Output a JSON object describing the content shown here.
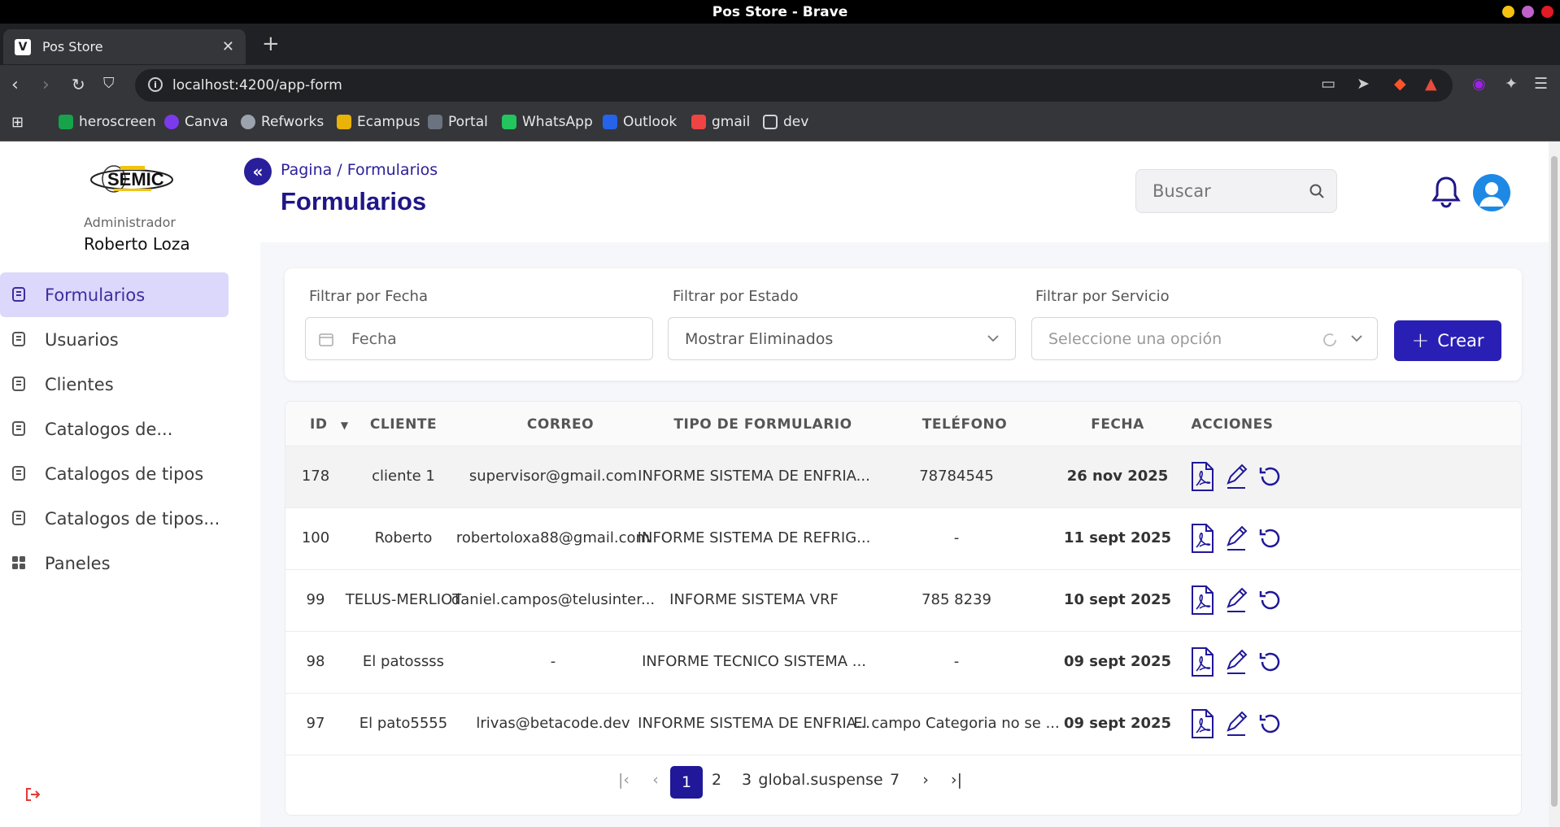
{
  "browser": {
    "window_title": "Pos Store - Brave",
    "tab_title": "Pos Store",
    "url": "localhost:4200/app-form",
    "bookmarks": [
      {
        "label": "heroscreen",
        "color": "#16a34a"
      },
      {
        "label": "Canva",
        "color": "#7c3aed"
      },
      {
        "label": "Refworks",
        "color": "#9ca3af"
      },
      {
        "label": "Ecampus",
        "color": "#eab308"
      },
      {
        "label": "Portal",
        "color": "#6b7280"
      },
      {
        "label": "WhatsApp",
        "color": "#22c55e"
      },
      {
        "label": "Outlook",
        "color": "#2563eb"
      },
      {
        "label": "gmail",
        "color": "#ef4444"
      },
      {
        "label": "dev",
        "color": "#d1d5db"
      }
    ]
  },
  "sidebar": {
    "role": "Administrador",
    "user_name": "Roberto Loza",
    "items": [
      {
        "label": "Formularios",
        "icon": "document-icon",
        "active": true
      },
      {
        "label": "Usuarios",
        "icon": "document-icon",
        "active": false
      },
      {
        "label": "Clientes",
        "icon": "document-icon",
        "active": false
      },
      {
        "label": "Catalogos de...",
        "icon": "document-icon",
        "active": false
      },
      {
        "label": "Catalogos de tipos",
        "icon": "document-icon",
        "active": false
      },
      {
        "label": "Catalogos de tipos...",
        "icon": "document-icon",
        "active": false
      },
      {
        "label": "Paneles",
        "icon": "grid-icon",
        "active": false
      }
    ]
  },
  "header": {
    "breadcrumb": "Pagina / Formularios",
    "title": "Formularios",
    "search_placeholder": "Buscar"
  },
  "filters": {
    "date_label": "Filtrar por Fecha",
    "date_placeholder": "Fecha",
    "status_label": "Filtrar por Estado",
    "status_value": "Mostrar Eliminados",
    "service_label": "Filtrar por Servicio",
    "service_placeholder": "Seleccione una opción",
    "create_label": "Crear"
  },
  "table": {
    "columns": [
      "ID",
      "CLIENTE",
      "CORREO",
      "TIPO DE FORMULARIO",
      "TELÉFONO",
      "FECHA",
      "ACCIONES"
    ],
    "rows": [
      {
        "id": "178",
        "cliente": "cliente 1",
        "correo": "supervisor@gmail.com",
        "tipo": "INFORME SISTEMA DE ENFRIA...",
        "telefono": "78784545",
        "fecha": "26 nov 2025"
      },
      {
        "id": "100",
        "cliente": "Roberto",
        "correo": "robertoloxa88@gmail.com",
        "tipo": "INFORME SISTEMA DE REFRIG...",
        "telefono": "-",
        "fecha": "11 sept 2025"
      },
      {
        "id": "99",
        "cliente": "TELUS-MERLIOT",
        "correo": "daniel.campos@telusinter...",
        "tipo": "INFORME SISTEMA VRF",
        "telefono": "785 8239",
        "fecha": "10 sept 2025"
      },
      {
        "id": "98",
        "cliente": "El patossss",
        "correo": "-",
        "tipo": "INFORME TECNICO SISTEMA ...",
        "telefono": "-",
        "fecha": "09 sept 2025"
      },
      {
        "id": "97",
        "cliente": "El pato5555",
        "correo": "lrivas@betacode.dev",
        "tipo": "INFORME SISTEMA DE ENFRIA...",
        "telefono": "El campo Categoria  no se ...",
        "fecha": "09 sept 2025"
      }
    ]
  },
  "pagination": {
    "pages": [
      "1",
      "2",
      "3",
      "global.suspense",
      "7"
    ],
    "current": "1"
  },
  "colors": {
    "primary": "#2a1fb5",
    "active_bg": "#dcd8fb",
    "title": "#1f1687"
  }
}
